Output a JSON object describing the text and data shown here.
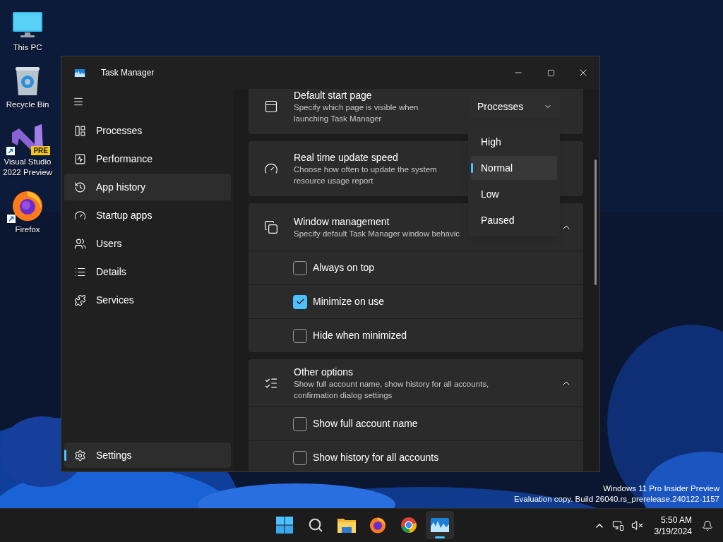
{
  "desktop_icons": [
    {
      "label": "This PC",
      "kind": "monitor"
    },
    {
      "label": "Recycle Bin",
      "kind": "recycle"
    },
    {
      "label": "Visual Studio 2022 Preview",
      "kind": "vs",
      "badge": "PRE"
    },
    {
      "label": "Firefox",
      "kind": "firefox"
    }
  ],
  "window": {
    "title": "Task Manager"
  },
  "sidebar": {
    "items": [
      {
        "label": "Processes",
        "kind": "processes",
        "selected": false,
        "hovered": false
      },
      {
        "label": "Performance",
        "kind": "performance",
        "selected": false,
        "hovered": false
      },
      {
        "label": "App history",
        "kind": "history",
        "selected": false,
        "hovered": true
      },
      {
        "label": "Startup apps",
        "kind": "startup",
        "selected": false,
        "hovered": false
      },
      {
        "label": "Users",
        "kind": "users",
        "selected": false,
        "hovered": false
      },
      {
        "label": "Details",
        "kind": "details",
        "selected": false,
        "hovered": false
      },
      {
        "label": "Services",
        "kind": "services",
        "selected": false,
        "hovered": false
      }
    ],
    "settings": {
      "label": "Settings",
      "selected": true
    }
  },
  "settings_cards": [
    {
      "kind": "dropdown",
      "title": "Default start page",
      "description": "Specify which page is visible when launching Task Manager",
      "value": "Processes"
    },
    {
      "kind": "plain",
      "title": "Real time update speed",
      "description": "Choose how often to update the system resource usage report"
    },
    {
      "kind": "expander",
      "title": "Window management",
      "description": "Specify default Task Manager window behavic",
      "expanded": true,
      "options": [
        {
          "label": "Always on top",
          "checked": false
        },
        {
          "label": "Minimize on use",
          "checked": true
        },
        {
          "label": "Hide when minimized",
          "checked": false
        }
      ]
    },
    {
      "kind": "expander",
      "title": "Other options",
      "description": "Show full account name, show history for all accounts, confirmation dialog settings",
      "expanded": true,
      "options": [
        {
          "label": "Show full account name",
          "checked": false
        },
        {
          "label": "Show history for all accounts",
          "checked": false
        }
      ]
    }
  ],
  "dropdown_menu": {
    "items": [
      {
        "label": "High",
        "selected": false
      },
      {
        "label": "Normal",
        "selected": true
      },
      {
        "label": "Low",
        "selected": false
      },
      {
        "label": "Paused",
        "selected": false
      }
    ]
  },
  "build_info": [
    "Windows 11 Pro Insider Preview",
    "Evaluation copy. Build 26040.rs_prerelease.240122-1157"
  ],
  "taskbar": {
    "apps": [
      {
        "kind": "start",
        "active": false
      },
      {
        "kind": "search",
        "active": false
      },
      {
        "kind": "explorer",
        "active": false
      },
      {
        "kind": "firefox",
        "active": false
      },
      {
        "kind": "chrome",
        "active": false
      },
      {
        "kind": "taskmanager",
        "active": true
      }
    ],
    "time": "5:50 AM",
    "date": "3/19/2024"
  }
}
